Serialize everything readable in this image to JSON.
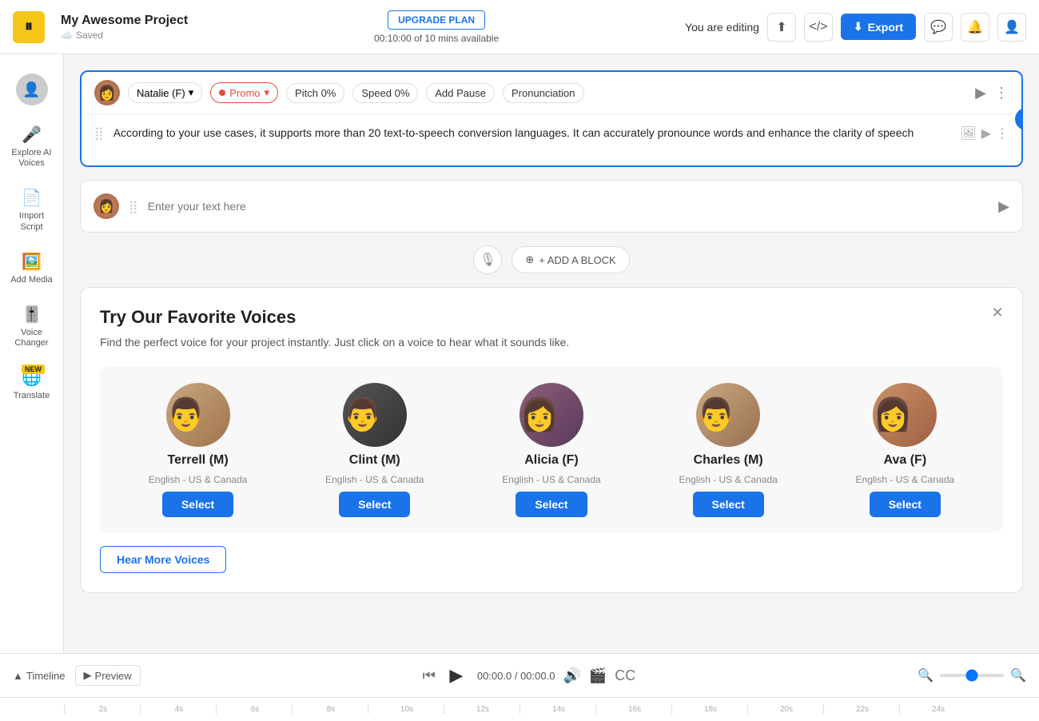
{
  "topbar": {
    "project_title": "My Awesome Project",
    "saved_label": "Saved",
    "upgrade_label": "UPGRADE PLAN",
    "timer": "00:10:00 of 10 mins available",
    "editing_label": "You are editing",
    "export_label": "Export"
  },
  "sidebar": {
    "items": [
      {
        "id": "explore",
        "label": "Explore AI Voices",
        "icon": "🎤"
      },
      {
        "id": "import",
        "label": "Import Script",
        "icon": "📄"
      },
      {
        "id": "media",
        "label": "Add Media",
        "icon": "🖼️"
      },
      {
        "id": "voice_changer",
        "label": "Voice Changer",
        "icon": "🎚️"
      },
      {
        "id": "translate",
        "label": "Translate",
        "icon": "🌐",
        "badge": "NEW"
      }
    ]
  },
  "voice_block": {
    "voice_name": "Natalie (F)",
    "promo_label": "Promo",
    "pitch_label": "Pitch",
    "pitch_value": "0%",
    "speed_label": "Speed",
    "speed_value": "0%",
    "add_pause_label": "Add Pause",
    "pronunciation_label": "Pronunciation",
    "text_content": "According to your use cases, it supports more than 20 text-to-speech conversion languages. It can accurately pronounce words and enhance the clarity of speech"
  },
  "empty_block": {
    "placeholder": "Enter your text here"
  },
  "add_block": {
    "label": "+ ADD A BLOCK"
  },
  "fav_voices": {
    "title": "Try Our Favorite Voices",
    "description": "Find the perfect voice for your project instantly. Just click on a\nvoice to hear what it sounds like.",
    "voices": [
      {
        "id": "terrell",
        "name": "Terrell (M)",
        "lang": "English - US & Canada",
        "select": "Select"
      },
      {
        "id": "clint",
        "name": "Clint (M)",
        "lang": "English - US & Canada",
        "select": "Select"
      },
      {
        "id": "alicia",
        "name": "Alicia (F)",
        "lang": "English - US & Canada",
        "select": "Select"
      },
      {
        "id": "charles",
        "name": "Charles (M)",
        "lang": "English - US & Canada",
        "select": "Select"
      },
      {
        "id": "ava",
        "name": "Ava (F)",
        "lang": "English - US & Canada",
        "select": "Select"
      }
    ],
    "hear_more_label": "Hear More Voices"
  },
  "timeline": {
    "label": "Timeline",
    "preview_label": "Preview",
    "time_current": "00:00.0",
    "time_total": "00:00.0",
    "ruler_marks": [
      "2s",
      "4s",
      "6s",
      "8s",
      "10s",
      "12s",
      "14s",
      "16s",
      "18s",
      "20s",
      "22s",
      "24s"
    ]
  }
}
